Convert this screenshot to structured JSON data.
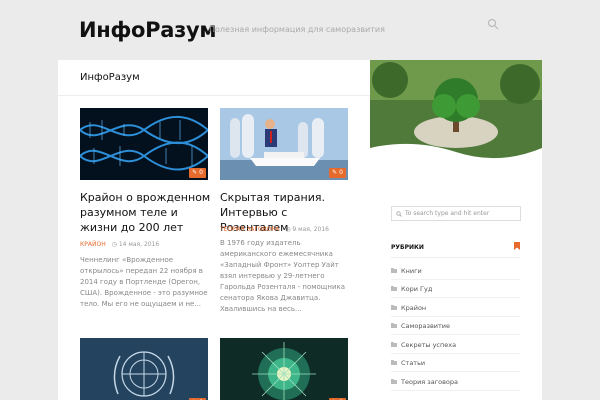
{
  "site": {
    "title": "ИнфоРазум",
    "tagline": "Полезная информация для саморазвития"
  },
  "content": {
    "heading": "ИнфоРазум",
    "posts": [
      {
        "title": "Крайон о врожденном разумном теле и жизни до 200 лет",
        "category": "Крайон",
        "date": "14 мая, 2016",
        "excerpt": "Ченнелинг «Врожденное открылось» передан 22 ноября в 2014 году в Портленде (Орегон, США). Врожденное - это разумное тело. Мы его не ощущаем и не...",
        "comments": "0"
      },
      {
        "title": "Скрытая тирания. Интервью с Розенталем",
        "category": "Теория заговора",
        "date": "9 мая, 2016",
        "excerpt": "В 1976 году издатель американского ежемесячника «Западный Фронт» Уолтер Уайт взял интервью у 29-летнего Гарольда Розенталя - помощника сенатора Якова Джавитца. Хвалившись на весь...",
        "comments": "0"
      },
      {
        "comments": "0"
      },
      {
        "comments": "0"
      }
    ]
  },
  "sidebar": {
    "search_placeholder": "To search type and hit enter",
    "widget_title": "РУБРИКИ",
    "categories": [
      "Книги",
      "Кори Гуд",
      "Крайон",
      "Саморазвитие",
      "Секреты успеха",
      "Статьи",
      "Теория заговора"
    ]
  },
  "colors": {
    "accent": "#e66a2c",
    "background": "#ebebeb"
  }
}
